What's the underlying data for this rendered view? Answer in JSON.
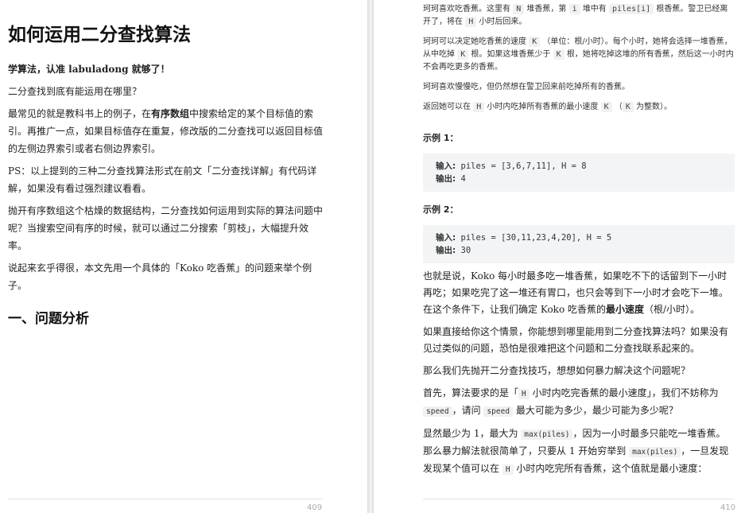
{
  "left": {
    "title": "如何运用二分查找算法",
    "intro_bold": "学算法，认准 labuladong 就够了！",
    "question": "二分查找到底有能运用在哪里？",
    "p1_a": "最常见的就是教科书上的例子，在",
    "p1_bold": "有序数组",
    "p1_b": "中搜索给定的某个目标值的索引。再推广一点，如果目标值存在重复，修改版的二分查找可以返回目标值的左侧边界索引或者右侧边界索引。",
    "p2": "PS：以上提到的三种二分查找算法形式在前文「二分查找详解」有代码详解，如果没有看过强烈建议看看。",
    "p3": "抛开有序数组这个枯燥的数据结构，二分查找如何运用到实际的算法问题中呢？当搜索空间有序的时候，就可以通过二分搜索「剪枝」，大幅提升效率。",
    "p4": "说起来玄乎得很，本文先用一个具体的「Koko 吃香蕉」的问题来举个例子。",
    "section": "一、问题分析",
    "page_number": "409"
  },
  "right": {
    "l1": "珂珂喜欢吃香蕉。这里有",
    "c_N": "N",
    "l2": "堆香蕉，第",
    "c_i": "i",
    "l3": "堆中有",
    "c_piles_i": "piles[i]",
    "l4": "根香蕉。警卫已经离开了，将在",
    "c_H": "H",
    "l5": "小时后回来。",
    "m1": "珂珂可以决定她吃香蕉的速度",
    "c_K": "K",
    "m2": "（单位：根/小时）。每个小时，她将会选择一堆香蕉，从中吃掉",
    "m3": "根。如果这堆香蕉少于",
    "m4": "根，她将吃掉这堆的所有香蕉，然后这一小时内不会再吃更多的香蕉。",
    "n1": "珂珂喜欢慢慢吃，但仍然想在警卫回来前吃掉所有的香蕉。",
    "o1": "返回她可以在",
    "o2": "小时内吃掉所有香蕉的最小速度",
    "o3": "（",
    "o4": "为整数）。",
    "ex1_label": "示例 1：",
    "ex1_in_k": "输入:",
    "ex1_in_v": "piles = [3,6,7,11], H = 8",
    "ex1_out_k": "输出:",
    "ex1_out_v": "4",
    "ex2_label": "示例 2：",
    "ex2_in_k": "输入:",
    "ex2_in_v": "piles = [30,11,23,4,20], H = 5",
    "ex2_out_k": "输出:",
    "ex2_out_v": "30",
    "q1_a": "也就是说，Koko 每小时最多吃一堆香蕉，如果吃不下的话留到下一小时再吃；如果吃完了这一堆还有胃口，也只会等到下一小时才会吃下一堆。在这个条件下，让我们确定 Koko 吃香蕉的",
    "q1_bold": "最小速度",
    "q1_b": "（根/小时）。",
    "q2": "如果直接给你这个情景，你能想到哪里能用到二分查找算法吗？如果没有见过类似的问题，恐怕是很难把这个问题和二分查找联系起来的。",
    "q3": "那么我们先抛开二分查找技巧，想想如何暴力解决这个问题呢？",
    "q4_a": "首先，算法要求的是「",
    "q4_H": "H",
    "q4_b": "小时内吃完香蕉的最小速度」，我们不妨称为",
    "q4_speed": "speed",
    "q4_c": "，请问",
    "q4_d": "最大可能为多少，最少可能为多少呢？",
    "q5_a": "显然最少为 1，最大为",
    "q5_max": "max(piles)",
    "q5_b": "，因为一小时最多只能吃一堆香蕉。那么暴力解法就很简单了，只要从 1 开始穷举到",
    "q5_c": "，一旦发现发现某个值可以在",
    "q5_d": "小时内吃完所有香蕉，这个值就是最小速度：",
    "page_number": "410"
  }
}
